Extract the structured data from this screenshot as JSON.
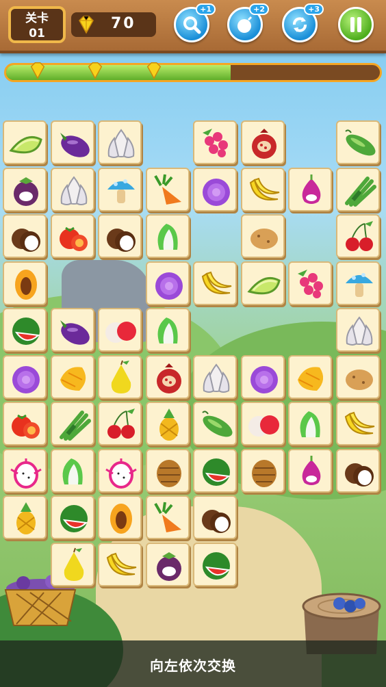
{
  "header": {
    "level_label": "关卡",
    "level_number": "01",
    "gem_count": "70",
    "tools": [
      {
        "name": "search",
        "badge": "+1"
      },
      {
        "name": "bomb",
        "badge": "+2"
      },
      {
        "name": "refresh",
        "badge": "+3"
      }
    ]
  },
  "progress": {
    "fraction": 0.6
  },
  "hint_text": "向左依次交换",
  "board": {
    "rows": [
      [
        "melon",
        "eggplant",
        "garlic",
        null,
        "raspberry",
        "pomegranate",
        null,
        "cucumber"
      ],
      [
        "mangosteen",
        "garlic",
        "mushroom",
        "carrot",
        "cabbage",
        "banana",
        "onion",
        "asparagus"
      ],
      [
        "coconut",
        "tomato",
        "coconut",
        "bokchoy",
        null,
        "potato",
        null,
        "cherry"
      ],
      [
        "papaya",
        null,
        null,
        "cabbage",
        "banana",
        "melon",
        "raspberry",
        "mushroom"
      ],
      [
        "watermelon",
        "eggplant",
        "lychee",
        "bokchoy",
        null,
        null,
        null,
        "garlic"
      ],
      [
        "cabbage",
        "mango",
        "pear",
        "pomegranate",
        "garlic",
        "cabbage",
        "mango",
        "potato"
      ],
      [
        "tomato",
        "asparagus",
        "cherry",
        "pineapple",
        "cucumber",
        "lychee",
        "bokchoy",
        "banana"
      ],
      [
        "dragonfruit",
        "bokchoy",
        "dragonfruit",
        "pinecone",
        "watermelon",
        "pinecone",
        "onion",
        "coconut"
      ],
      [
        "pineapple",
        "watermelon",
        "papaya",
        "carrot",
        "coconut",
        null,
        null,
        null
      ],
      [
        null,
        "pear",
        "banana",
        "mangosteen",
        "watermelon",
        null,
        null,
        null
      ]
    ]
  },
  "colors": {
    "wood": "#a86a35",
    "progress": "#5fae2a",
    "tile": "#fdf2cf"
  }
}
